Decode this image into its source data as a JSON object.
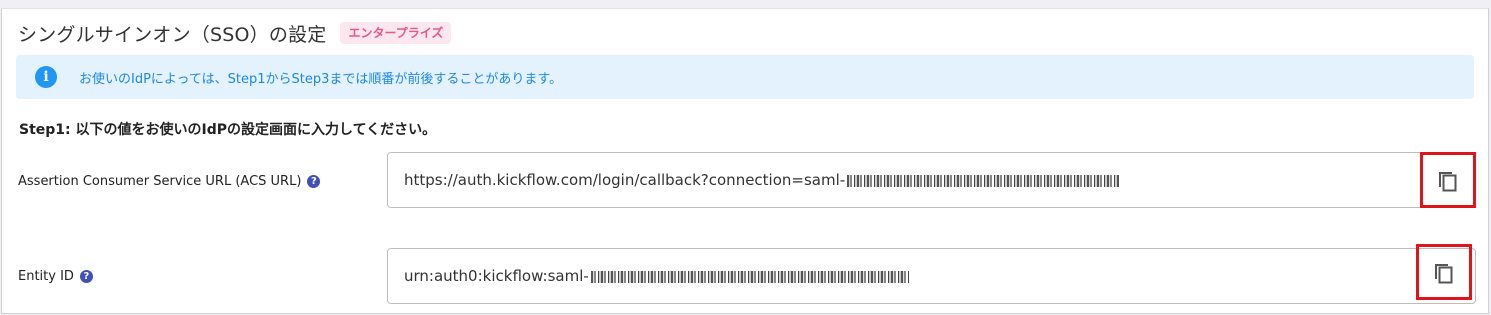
{
  "header": {
    "title": "シングルサインオン（SSO）の設定",
    "badge": "エンタープライズ"
  },
  "info": {
    "icon": "info-icon",
    "text": "お使いのIdPによっては、Step1からStep3までは順番が前後することがあります。"
  },
  "step1": {
    "heading": "Step1: 以下の値をお使いのIdPの設定画面に入力してください。"
  },
  "fields": [
    {
      "label": "Assertion Consumer Service URL (ACS URL)",
      "value": "https://auth.kickflow.com/login/callback?connection=saml-",
      "help_icon": "help-icon",
      "copy_icon": "copy-icon"
    },
    {
      "label": "Entity ID",
      "value": "urn:auth0:kickflow:saml-",
      "help_icon": "help-icon",
      "copy_icon": "copy-icon"
    }
  ],
  "colors": {
    "badge_text": "#e8588a",
    "badge_bg": "#fde7ef",
    "info_bg": "#e3f2fc",
    "info_text": "#1e88e5",
    "highlight": "#e0141c"
  }
}
